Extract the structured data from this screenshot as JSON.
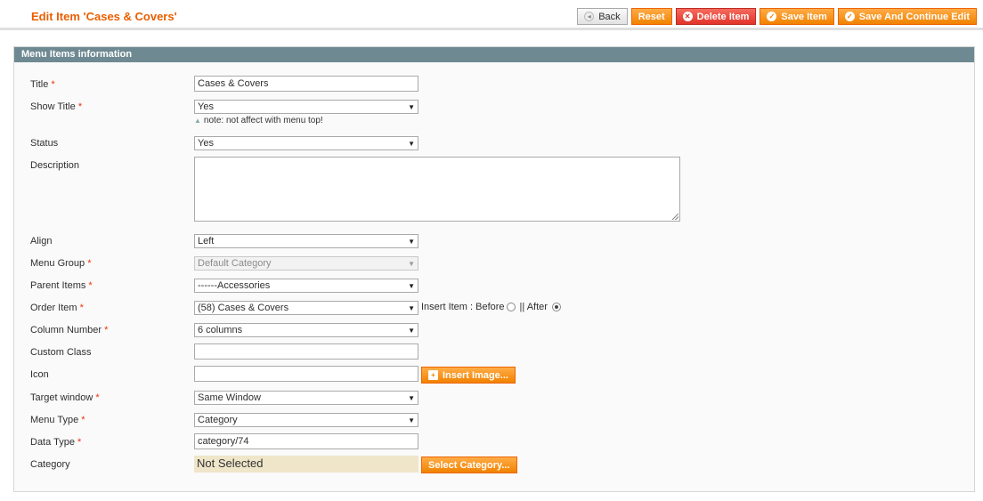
{
  "header": {
    "title": "Edit Item 'Cases & Covers'",
    "buttons": {
      "back": "Back",
      "reset": "Reset",
      "delete": "Delete Item",
      "save": "Save Item",
      "save_continue": "Save And Continue Edit"
    }
  },
  "panel": {
    "title": "Menu Items information"
  },
  "form": {
    "title": {
      "label": "Title",
      "value": "Cases & Covers"
    },
    "show_title": {
      "label": "Show Title",
      "value": "Yes",
      "note": "note: not affect with menu top!"
    },
    "status": {
      "label": "Status",
      "value": "Yes"
    },
    "description": {
      "label": "Description",
      "value": ""
    },
    "align": {
      "label": "Align",
      "value": "Left"
    },
    "menu_group": {
      "label": "Menu Group",
      "value": "Default Category"
    },
    "parent_items": {
      "label": "Parent Items",
      "value": "------Accessories"
    },
    "order_item": {
      "label": "Order Item",
      "value": "(58) Cases & Covers",
      "insert_label": "Insert Item : Before",
      "sep": "|| After"
    },
    "column_number": {
      "label": "Column Number",
      "value": "6 columns"
    },
    "custom_class": {
      "label": "Custom Class",
      "value": ""
    },
    "icon": {
      "label": "Icon",
      "value": "",
      "button": "Insert Image..."
    },
    "target_window": {
      "label": "Target window",
      "value": "Same Window"
    },
    "menu_type": {
      "label": "Menu Type",
      "value": "Category"
    },
    "data_type": {
      "label": "Data Type",
      "value": "category/74"
    },
    "category": {
      "label": "Category",
      "value": "Not Selected",
      "button": "Select Category..."
    }
  },
  "required_mark": "*",
  "colors": {
    "accent": "#eb5e00",
    "button": "#f18200",
    "delete": "#e2332a",
    "panel_header": "#6f8992"
  }
}
